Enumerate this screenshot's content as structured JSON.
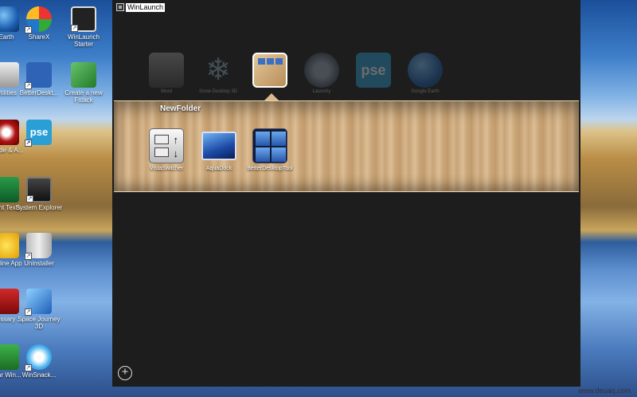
{
  "desktop": {
    "icons": [
      {
        "label": "Earth",
        "x": 0
      },
      {
        "label": "ShareX"
      },
      {
        "label": "WinLaunch Starter"
      },
      {
        "label": "Utilities"
      },
      {
        "label": "BetterDeskt..."
      },
      {
        "label": "Create a new Fstack"
      },
      {
        "label": "Guide & A..."
      },
      {
        "label": "pse"
      },
      {
        "label": "Instant Texts ..."
      },
      {
        "label": "System Explorer"
      },
      {
        "label": "Online App"
      },
      {
        "label": "Uninstaller"
      },
      {
        "label": "Glossary ..."
      },
      {
        "label": "Space Journey 3D"
      },
      {
        "label": "Star Win..."
      },
      {
        "label": "WinSnack..."
      }
    ]
  },
  "window": {
    "title": "WinLaunch",
    "top_icons": [
      {
        "label": "Word"
      },
      {
        "label": "Snow Desktop 3D"
      },
      {
        "label": "NewFolder"
      },
      {
        "label": "Launchy"
      },
      {
        "label": "pse"
      },
      {
        "label": "Google Earth"
      }
    ],
    "folder": {
      "title": "NewFolder",
      "items": [
        {
          "label": "VistaSwitcher"
        },
        {
          "label": "AquaDock"
        },
        {
          "label": "BetterDesktopTool"
        }
      ]
    },
    "add_label": "+"
  },
  "watermark": "www.deuaq.com",
  "colors": {
    "window_bg": "#1c1c1c",
    "folder_wood": "#c9a476",
    "accent_blue": "#2f63b5"
  }
}
